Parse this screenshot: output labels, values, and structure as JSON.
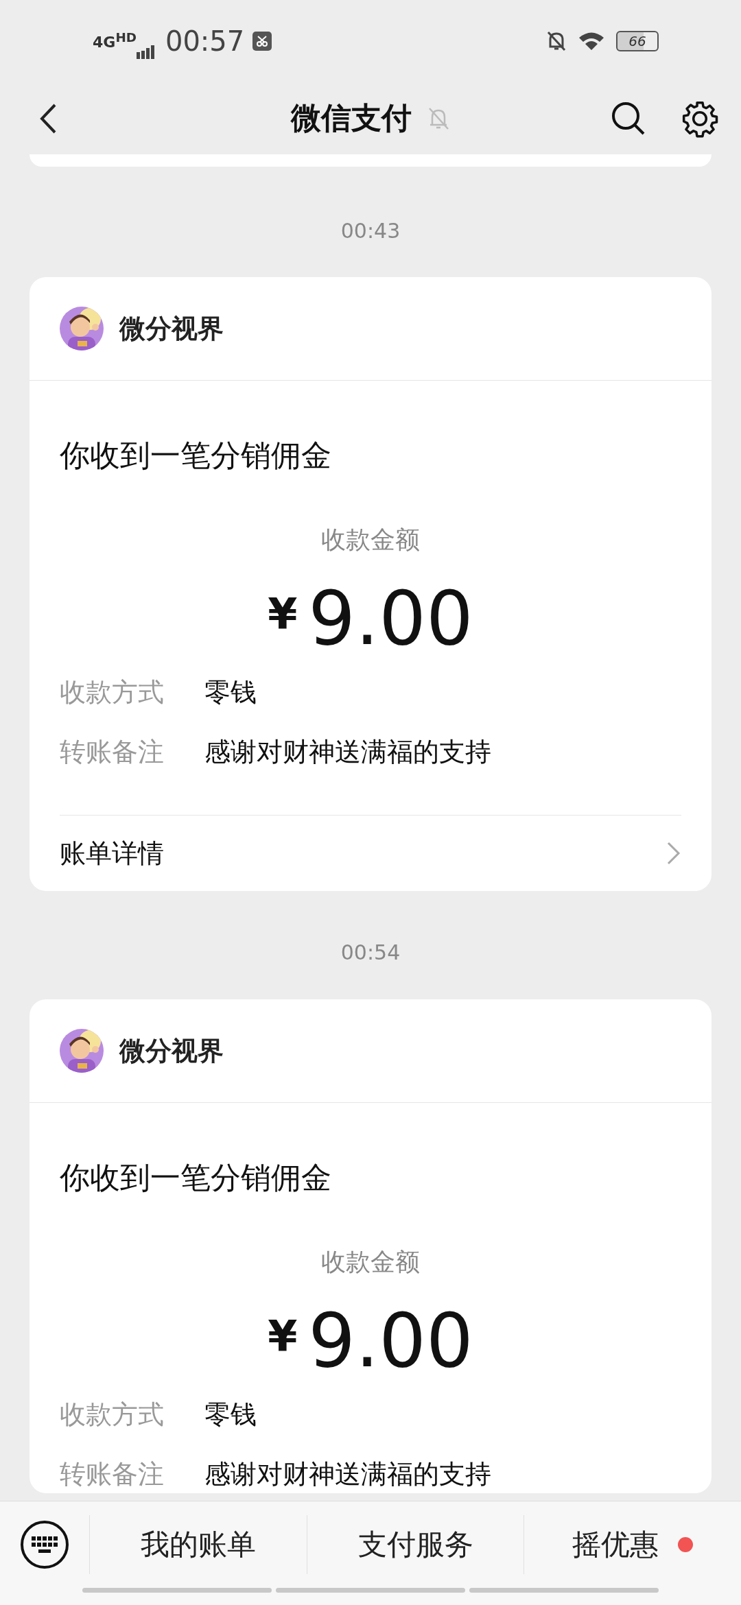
{
  "status_bar": {
    "network": "4G$^{HD}$",
    "time": "00:57",
    "battery": "66"
  },
  "header": {
    "title": "微信支付",
    "muted": true
  },
  "messages": [
    {
      "time": "00:43",
      "sender": "微分视界",
      "title": "你收到一笔分销佣金",
      "amount_label": "收款金额",
      "currency": "¥",
      "amount": "9.00",
      "fields": [
        {
          "label": "收款方式",
          "value": "零钱"
        },
        {
          "label": "转账备注",
          "value": "感谢对财神送满福的支持"
        }
      ],
      "link": "账单详情"
    },
    {
      "time": "00:54",
      "sender": "微分视界",
      "title": "你收到一笔分销佣金",
      "amount_label": "收款金额",
      "currency": "¥",
      "amount": "9.00",
      "fields": [
        {
          "label": "收款方式",
          "value": "零钱"
        },
        {
          "label": "转账备注",
          "value": "感谢对财神送满福的支持"
        }
      ]
    }
  ],
  "bottom_menu": [
    {
      "label": "我的账单",
      "dot": false
    },
    {
      "label": "支付服务",
      "dot": false
    },
    {
      "label": "摇优惠",
      "dot": true
    }
  ]
}
